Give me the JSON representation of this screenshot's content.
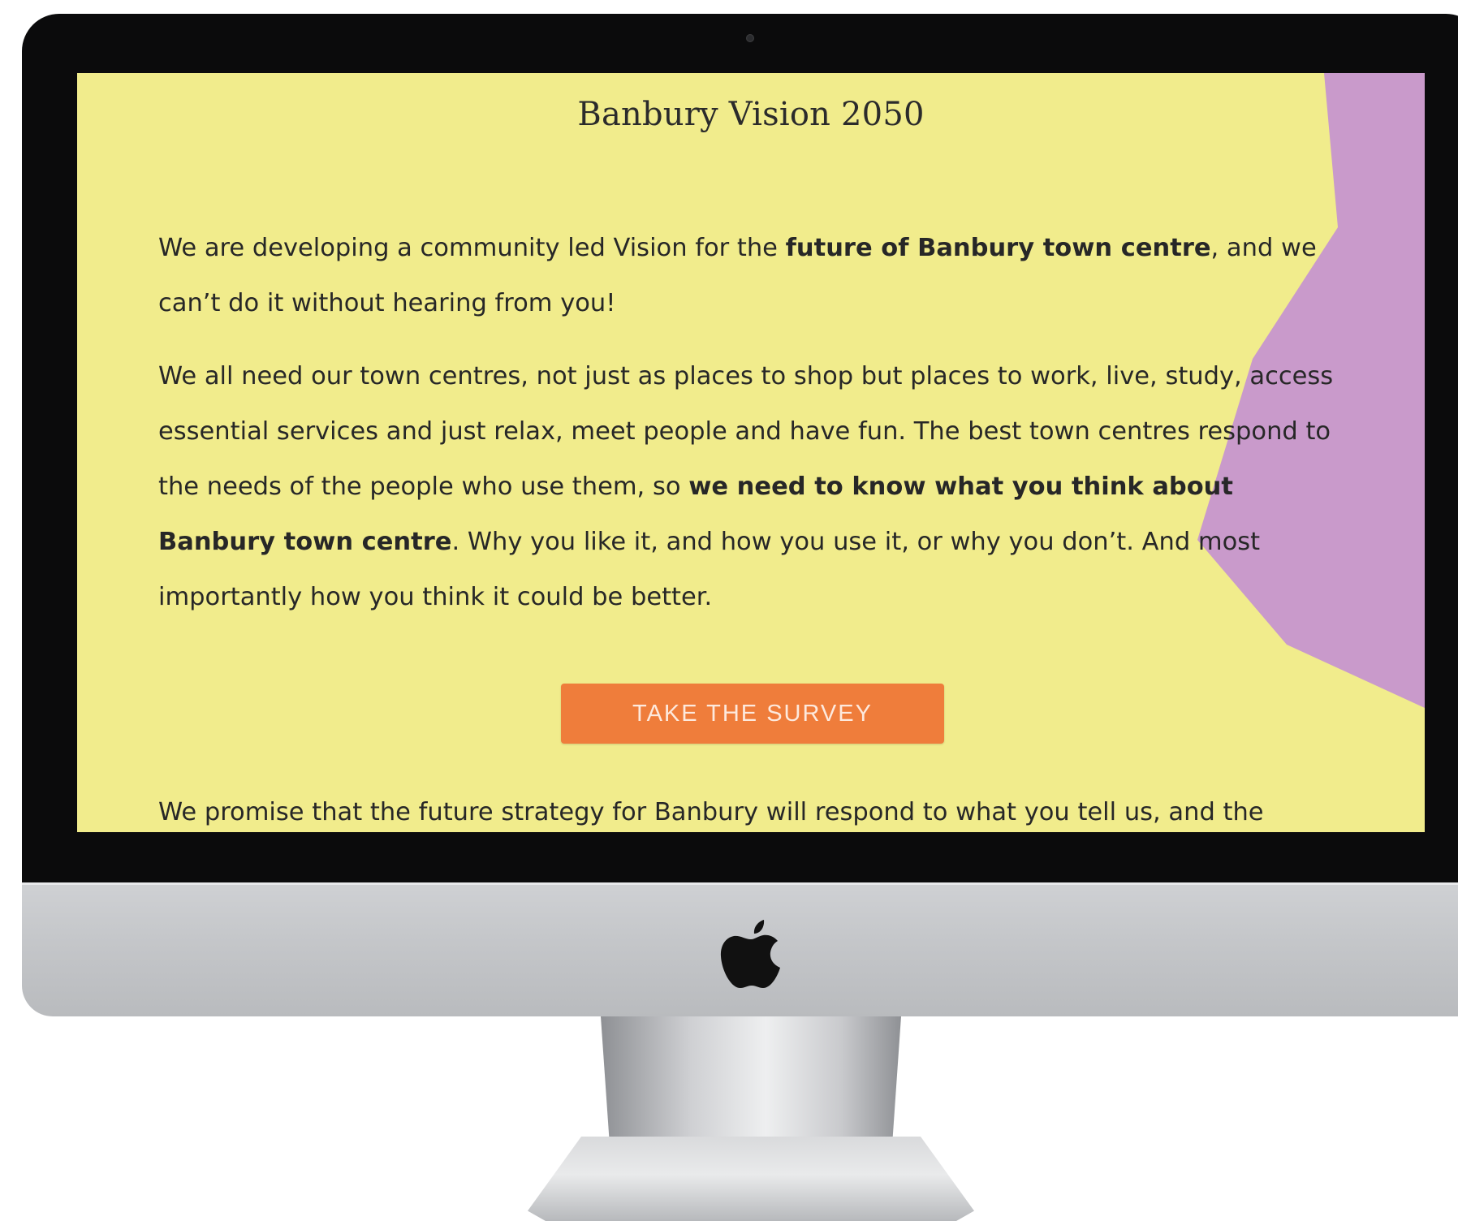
{
  "page": {
    "title": "Banbury Vision 2050",
    "paragraph1": {
      "part1": "We are developing a community led Vision for the ",
      "bold1": "future of Banbury town centre",
      "part2": ", and we can’t do it without hearing from you!"
    },
    "paragraph2": {
      "part1": "We all need our town centres, not just as places to shop but places to work, live, study, access essential services and just relax, meet people and have fun. The best town centres respond to the needs of the people who use them, so ",
      "bold1": "we need to know what you think about Banbury town centre",
      "part2": ". Why you like it, and how you use it, or why you don’t. And most importantly how you think it could be better."
    },
    "cta_label": "TAKE THE SURVEY",
    "paragraph3_partial": "We promise that the future strategy for Banbury will respond to what you tell us, and the"
  },
  "colors": {
    "background": "#f1ec8c",
    "accent_shape": "#c99acb",
    "button": "#ef7d3b",
    "text": "#272727"
  },
  "icons": {
    "monitor_logo": "apple-logo-icon"
  }
}
